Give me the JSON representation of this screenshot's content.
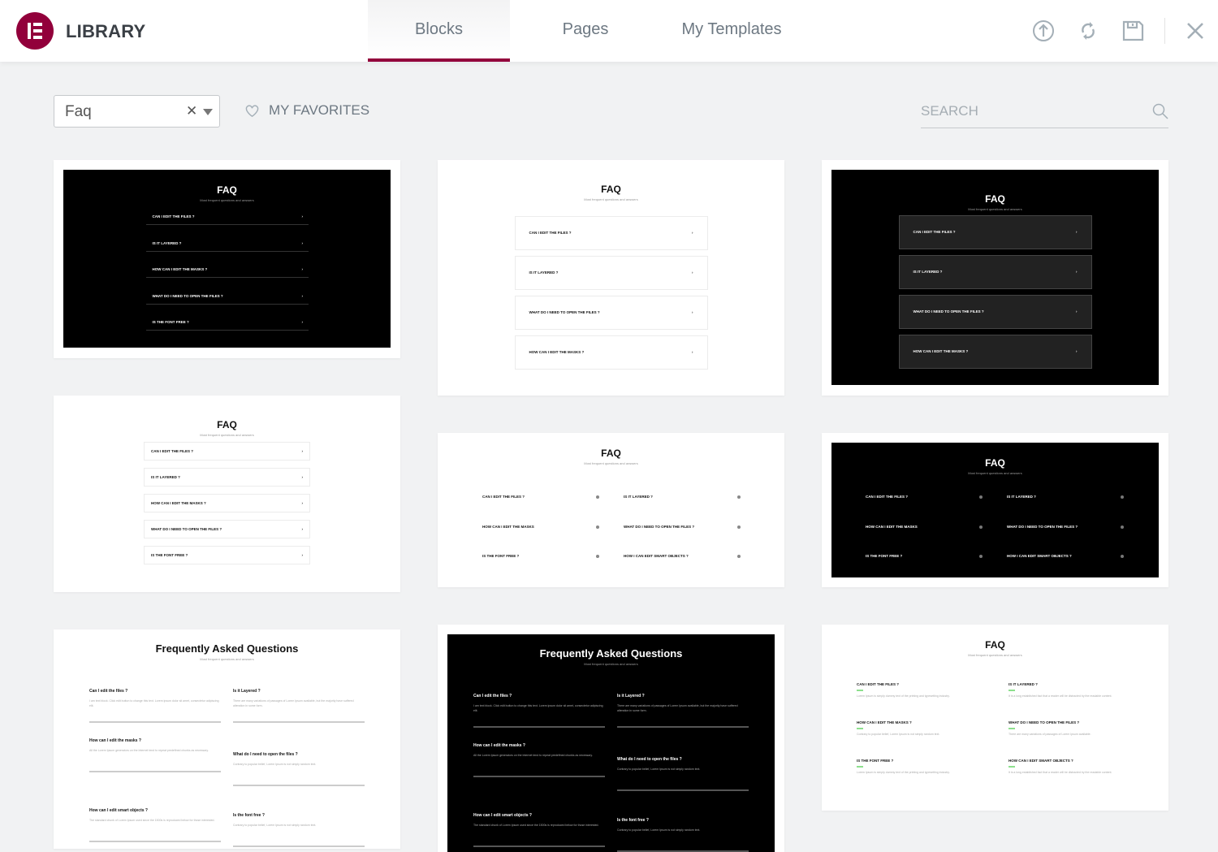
{
  "header": {
    "brand": "LIBRARY",
    "tabs": [
      {
        "label": "Blocks",
        "active": true
      },
      {
        "label": "Pages",
        "active": false
      },
      {
        "label": "My Templates",
        "active": false
      }
    ],
    "icons": [
      "upload-icon",
      "sync-icon",
      "save-icon",
      "close-icon"
    ],
    "accent": "#92003b"
  },
  "toolbar": {
    "category_value": "Faq",
    "favorites_label": "MY FAVORITES",
    "search_placeholder": "SEARCH"
  },
  "faq": {
    "title": "FAQ",
    "long_title": "Frequently Asked Questions",
    "subtitle": "Most frequent questions and answers"
  },
  "cards": [
    {
      "style": "list",
      "theme": "dark",
      "questions": [
        "CAN I EDIT THE FILES ?",
        "IS IT LAYERED ?",
        "HOW CAN I EDIT THE MASKS ?",
        "WHAT DO I NEED TO OPEN THE FILES ?",
        "IS THE FONT FREE ?"
      ]
    },
    {
      "style": "boxed",
      "theme": "light",
      "questions": [
        "CAN I EDIT THE FILES ?",
        "IS IT LAYERED ?",
        "WHAT DO I NEED TO OPEN THE FILES ?",
        "HOW CAN I EDIT THE MASKS ?"
      ]
    },
    {
      "style": "boxed",
      "theme": "dark",
      "questions": [
        "CAN I EDIT THE FILES ?",
        "IS IT LAYERED ?",
        "WHAT DO I NEED TO OPEN THE FILES ?",
        "HOW CAN I EDIT THE MASKS ?"
      ]
    },
    {
      "style": "boxed-small",
      "theme": "light",
      "questions": [
        "CAN I EDIT THE FILES ?",
        "IS IT LAYERED ?",
        "HOW CAN I EDIT THE MASKS ?",
        "WHAT DO I NEED TO OPEN THE FILES ?",
        "IS THE FONT FREE ?"
      ]
    },
    {
      "style": "dots",
      "theme": "light",
      "questions": [
        "CAN I EDIT THE FILES ?",
        "IS IT LAYERED ?",
        "HOW CAN I EDIT THE MASKS",
        "WHAT DO I NEED TO OPEN THE FILES ?",
        "IS THE FONT FREE ?",
        "HOW I CAN EDIT SMART OBJECTS ?"
      ]
    },
    {
      "style": "dots",
      "theme": "dark",
      "questions": [
        "CAN I EDIT THE FILES ?",
        "IS IT LAYERED ?",
        "HOW CAN I EDIT THE MASKS",
        "WHAT DO I NEED TO OPEN THE FILES ?",
        "IS THE FONT FREE ?",
        "HOW I CAN EDIT SMART OBJECTS ?"
      ]
    },
    {
      "style": "long",
      "theme": "light",
      "questions": [
        "Can I edit the files ?",
        "Is it Layered ?",
        "How can I edit the masks ?",
        "What do I need to open the files ?",
        "How can I edit smart objects ?",
        "Is the font free ?"
      ],
      "answers": [
        "I am text block. Click edit button to change this text. Lorem ipsum dolor sit amet, consectetur adipiscing elit.",
        "There are many variations of passages of Lorem Ipsum available, but the majority have suffered alteration in some form.",
        "All the Lorem Ipsum generators on the Internet tend to repeat predefined chunks as necessary.",
        "Contrary to popular belief, Lorem Ipsum is not simply random text.",
        "The standard chunk of Lorem Ipsum used since the 1500s is reproduced below for those interested.",
        "Contrary to popular belief, Lorem Ipsum is not simply random text."
      ]
    },
    {
      "style": "long",
      "theme": "dark",
      "questions": [
        "Can I edit the files ?",
        "Is it Layered ?",
        "How can I edit the masks ?",
        "What do I need to open the files ?",
        "How can I edit smart objects ?",
        "Is the font free ?"
      ],
      "answers": [
        "I am text block. Click edit button to change this text. Lorem ipsum dolor sit amet, consectetur adipiscing elit.",
        "There are many variations of passages of Lorem Ipsum available, but the majority have suffered alteration in some form.",
        "All the Lorem Ipsum generators on the Internet tend to repeat predefined chunks as necessary.",
        "Contrary to popular belief, Lorem Ipsum is not simply random text.",
        "The standard chunk of Lorem Ipsum used since the 1500s is reproduced below for those interested.",
        "Contrary to popular belief, Lorem Ipsum is not simply random text."
      ]
    },
    {
      "style": "green",
      "theme": "light",
      "accent": "#8ee08e",
      "questions": [
        "CAN I EDIT THE FILES ?",
        "IS IT LAYERED ?",
        "HOW CAN I EDIT THE MASKS ?",
        "WHAT DO I NEED TO OPEN THE FILES ?",
        "IS THE FONT FREE ?",
        "HOW CAN I EDIT SMART OBJECTS ?"
      ],
      "answers": [
        "Lorem Ipsum is simply dummy text of the printing and typesetting industry.",
        "It is a long established fact that a reader will be distracted by the readable content.",
        "Contrary to popular belief, Lorem Ipsum is not simply random text.",
        "There are many variations of passages of Lorem Ipsum available.",
        "Lorem Ipsum is simply dummy text of the printing and typesetting industry.",
        "It is a long established fact that a reader will be distracted by the readable content."
      ]
    }
  ]
}
